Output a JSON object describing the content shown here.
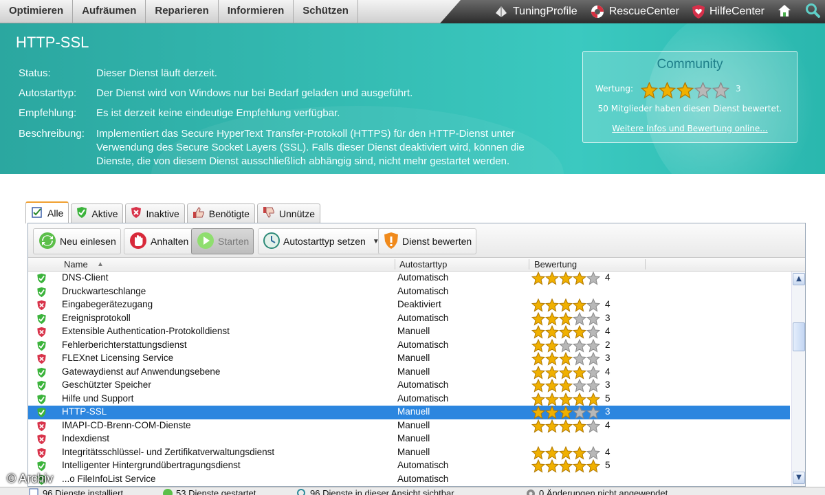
{
  "top_menu": [
    "Optimieren",
    "Aufräumen",
    "Reparieren",
    "Informieren",
    "Schützen"
  ],
  "top_links": [
    {
      "label": "TuningProfile",
      "icon": "tuning-profile-icon"
    },
    {
      "label": "RescueCenter",
      "icon": "lifebuoy-icon"
    },
    {
      "label": "HilfeCenter",
      "icon": "shield-heart-icon"
    }
  ],
  "service": {
    "title": "HTTP-SSL",
    "status_label": "Status:",
    "status": "Dieser Dienst läuft derzeit.",
    "autostart_label": "Autostarttyp:",
    "autostart": "Der Dienst wird von Windows nur bei Bedarf geladen und ausgeführt.",
    "recommendation_label": "Empfehlung:",
    "recommendation": "Es ist derzeit keine eindeutige Empfehlung verfügbar.",
    "description_label": "Beschreibung:",
    "description_line1": "Implementiert das Secure HyperText Transfer-Protokoll (HTTPS) für den HTTP-Dienst unter",
    "description_line2": "Verwendung des Secure Socket Layers (SSL). Falls dieser Dienst deaktiviert wird, können die",
    "description_line3": "Dienste, die von diesem Dienst ausschließlich abhängig sind, nicht mehr gestartet werden."
  },
  "community": {
    "title": "Community",
    "rating_label": "Wertung:",
    "rating": 3,
    "rating_text": "3",
    "members_text": "50 Mitglieder haben diesen Dienst bewertet.",
    "link_text": "Weitere Infos und Bewertung online..."
  },
  "tabs": [
    {
      "label": "Alle",
      "icon": "checklist-icon",
      "active": true
    },
    {
      "label": "Aktive",
      "icon": "green-shield-icon",
      "active": false
    },
    {
      "label": "Inaktive",
      "icon": "red-shield-icon",
      "active": false
    },
    {
      "label": "Benötigte",
      "icon": "thumbs-up-icon",
      "active": false
    },
    {
      "label": "Unnütze",
      "icon": "thumbs-down-icon",
      "active": false
    }
  ],
  "toolbar": {
    "refresh": "Neu einlesen",
    "stop": "Anhalten",
    "start": "Starten",
    "autostart": "Autostarttyp setzen",
    "rate": "Dienst bewerten"
  },
  "columns": {
    "name": "Name",
    "autostart": "Autostarttyp",
    "rating": "Bewertung"
  },
  "services": [
    {
      "name": "DNS-Client",
      "autostart": "Automatisch",
      "rating": 4,
      "rating_text": "4",
      "active": true
    },
    {
      "name": "Druckwarteschlange",
      "autostart": "Automatisch",
      "rating": null,
      "rating_text": "",
      "active": true
    },
    {
      "name": "Eingabegerätezugang",
      "autostart": "Deaktiviert",
      "rating": 4,
      "rating_text": "4",
      "active": false
    },
    {
      "name": "Ereignisprotokoll",
      "autostart": "Automatisch",
      "rating": 3,
      "rating_text": "3",
      "active": true
    },
    {
      "name": "Extensible Authentication-Protokolldienst",
      "autostart": "Manuell",
      "rating": 4,
      "rating_text": "4",
      "active": false
    },
    {
      "name": "Fehlerberichterstattungsdienst",
      "autostart": "Automatisch",
      "rating": 2,
      "rating_text": "2",
      "active": true
    },
    {
      "name": "FLEXnet Licensing Service",
      "autostart": "Manuell",
      "rating": 3,
      "rating_text": "3",
      "active": false
    },
    {
      "name": "Gatewaydienst auf Anwendungsebene",
      "autostart": "Manuell",
      "rating": 4,
      "rating_text": "4",
      "active": true
    },
    {
      "name": "Geschützter Speicher",
      "autostart": "Automatisch",
      "rating": 3,
      "rating_text": "3",
      "active": true
    },
    {
      "name": "Hilfe und Support",
      "autostart": "Automatisch",
      "rating": 5,
      "rating_text": "5",
      "active": true
    },
    {
      "name": "HTTP-SSL",
      "autostart": "Manuell",
      "rating": 3,
      "rating_text": "3",
      "active": true,
      "selected": true
    },
    {
      "name": "IMAPI-CD-Brenn-COM-Dienste",
      "autostart": "Manuell",
      "rating": 4,
      "rating_text": "4",
      "active": false
    },
    {
      "name": "Indexdienst",
      "autostart": "Manuell",
      "rating": null,
      "rating_text": "",
      "active": false
    },
    {
      "name": "Integritätsschlüssel- und Zertifikatverwaltungsdienst",
      "autostart": "Manuell",
      "rating": 4,
      "rating_text": "4",
      "active": false
    },
    {
      "name": "Intelligenter Hintergrundübertragungsdienst",
      "autostart": "Automatisch",
      "rating": 5,
      "rating_text": "5",
      "active": true
    },
    {
      "name": "...o FileInfoList Service",
      "autostart": "Automatisch",
      "rating": null,
      "rating_text": "",
      "active": true
    }
  ],
  "statusbar": [
    {
      "text": "96 Dienste installiert",
      "icon": "checklist-icon"
    },
    {
      "text": "53 Dienste gestartet",
      "icon": "play-icon"
    },
    {
      "text": "96 Dienste in dieser Ansicht sichtbar",
      "icon": "magnifier-icon"
    },
    {
      "text": "0 Änderungen nicht angewendet",
      "icon": "gear-icon"
    }
  ],
  "watermark": "© Archiv",
  "colors": {
    "header": "#35bdb4",
    "selection": "#2c86df",
    "star": "#f0b000",
    "active": "#3bb33b",
    "inactive": "#d8334a"
  }
}
